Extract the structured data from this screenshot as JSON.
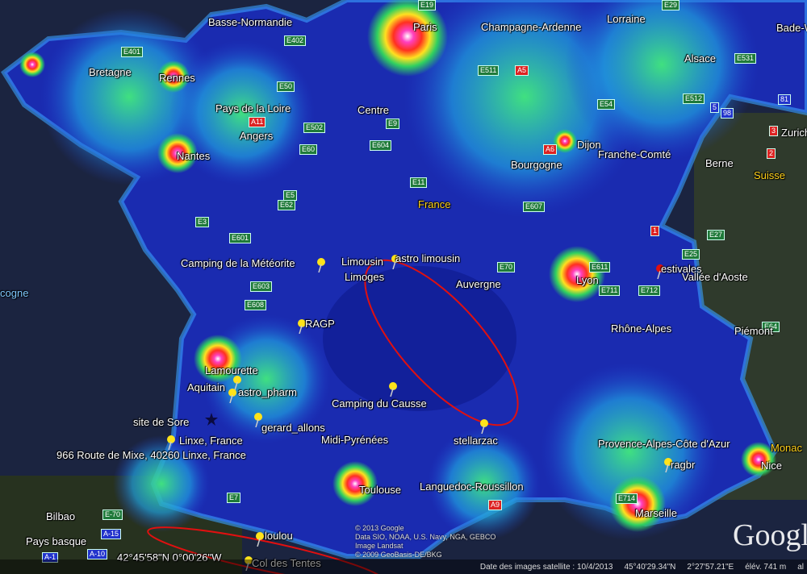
{
  "places": [
    "Basse-Normandie",
    "Paris",
    "Champagne-Ardenne",
    "Lorraine",
    "Bade-Wurt",
    "Bretagne",
    "Rennes",
    "Alsace",
    "Pays de la Loire",
    "Centre",
    "Angers",
    "Nantes",
    "Dijon",
    "Bourgogne",
    "Franche-Comté",
    "Berne",
    "Suisse",
    "Zurich",
    "France",
    "Camping de la Météorite",
    "Limousin",
    "astro limousin",
    "Limoges",
    "Auvergne",
    "Lyon",
    "estivales",
    "Vallée d'Aoste",
    "cogne",
    "RAGP",
    "Rhône-Alpes",
    "Piémont",
    "Lamourette",
    "Aquitain",
    "astro_pharm",
    "Camping du Causse",
    "site de Sore",
    "gerard_allons",
    "Linxe, France",
    "Midi-Pyrénées",
    "stellarzac",
    "Provence-Alpes-Côte d'Azur",
    "Monac",
    "966 Route de Mixe, 40260 Linxe, France",
    "ragbr",
    "Nice",
    "Toulouse",
    "Languedoc-Roussillon",
    "Marseille",
    "Bilbao",
    "loulou",
    "Pays basque",
    "Col des Tentes",
    "42°45'58\"N 0°00'26\"W"
  ],
  "roads": [
    "E402",
    "E401",
    "E50",
    "E511",
    "A5",
    "E54",
    "E512",
    "A11",
    "E502",
    "E9",
    "E60",
    "E604",
    "A6",
    "E5",
    "E62",
    "E11",
    "E607",
    "E3",
    "E601",
    "E70",
    "E611",
    "E711",
    "E712",
    "E603",
    "E608",
    "E25",
    "E27",
    "E64",
    "E7",
    "A9",
    "E714",
    "E-70",
    "A-15",
    "A-1",
    "A-10",
    "E19",
    "E29",
    "81",
    "5",
    "98",
    "3",
    "2",
    "1",
    "E531",
    "E60"
  ],
  "attribution": [
    "© 2013 Google",
    "Data SIO, NOAA, U.S. Navy, NGA, GEBCO",
    "Image Landsat",
    "© 2009 GeoBasis-DE/BKG"
  ],
  "status": {
    "date": "Date des images satellite : 10/4/2013",
    "lat": "45°40'29.34\"N",
    "lon": "2°27'57.21\"E",
    "elev_label": "élév.",
    "elev": "741 m",
    "alt": "al"
  },
  "logo": "Google",
  "colors": {
    "sea": "#1b2440",
    "dark_sky": "#1424a0",
    "light_pollution_high": "#ff2020",
    "pin": "#ffe31a",
    "circle": "#e01010"
  }
}
